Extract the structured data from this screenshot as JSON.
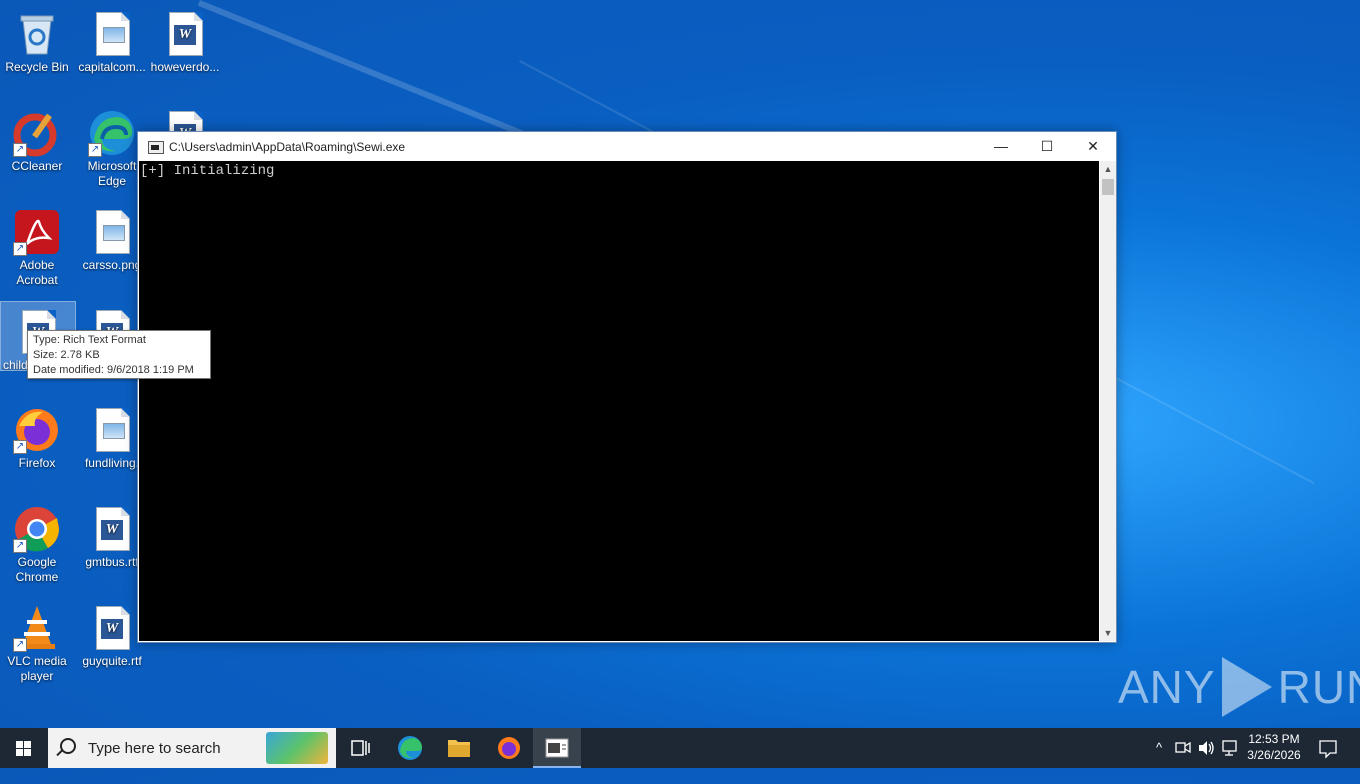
{
  "desktop": {
    "icons": [
      {
        "label": "Recycle Bin",
        "icon": "recycle-bin-icon"
      },
      {
        "label": "capitalcom...",
        "icon": "image-file-icon"
      },
      {
        "label": "howeverdo...",
        "icon": "word-document-icon"
      },
      {
        "label": "CCleaner",
        "icon": "ccleaner-icon"
      },
      {
        "label": "Microsoft Edge",
        "icon": "edge-icon"
      },
      {
        "label": "Adobe Acrobat",
        "icon": "acrobat-icon"
      },
      {
        "label": "carsso.png",
        "icon": "image-file-icon"
      },
      {
        "label": "child",
        "icon": "word-document-icon"
      },
      {
        "label": "Firefox",
        "icon": "firefox-icon"
      },
      {
        "label": "fundliving.",
        "icon": "image-file-icon"
      },
      {
        "label": "Google Chrome",
        "icon": "chrome-icon"
      },
      {
        "label": "gmtbus.rtf",
        "icon": "word-document-icon"
      },
      {
        "label": "VLC media player",
        "icon": "vlc-icon"
      },
      {
        "label": "guyquite.rtf",
        "icon": "word-document-icon"
      }
    ]
  },
  "tooltip": {
    "type": "Type: Rich Text Format",
    "size": "Size: 2.78 KB",
    "modified": "Date modified: 9/6/2018 1:19 PM"
  },
  "console_window": {
    "title": "C:\\Users\\admin\\AppData\\Roaming\\Sewi.exe",
    "output": "[+] Initializing",
    "minimize": "—",
    "maximize": "☐",
    "close": "✕"
  },
  "watermark": {
    "left": "ANY",
    "right": "RUN"
  },
  "taskbar": {
    "search_placeholder": "Type here to search",
    "time": "12:53 PM",
    "date": "3/26/2026",
    "tray_chevron": "^"
  },
  "colors": {
    "accent": "#0a74da",
    "taskbar": "#1d2834",
    "console_bg": "#000000"
  }
}
